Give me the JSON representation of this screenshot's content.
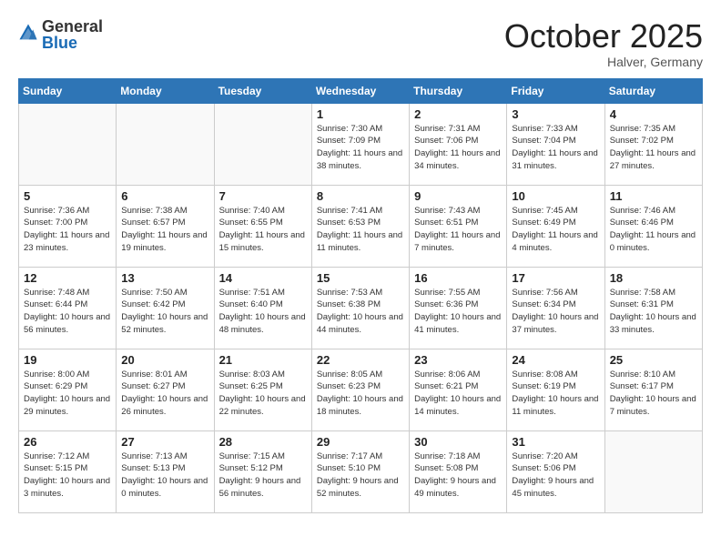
{
  "header": {
    "logo_general": "General",
    "logo_blue": "Blue",
    "month_title": "October 2025",
    "location": "Halver, Germany"
  },
  "days_of_week": [
    "Sunday",
    "Monday",
    "Tuesday",
    "Wednesday",
    "Thursday",
    "Friday",
    "Saturday"
  ],
  "weeks": [
    [
      {
        "day": "",
        "info": ""
      },
      {
        "day": "",
        "info": ""
      },
      {
        "day": "",
        "info": ""
      },
      {
        "day": "1",
        "info": "Sunrise: 7:30 AM\nSunset: 7:09 PM\nDaylight: 11 hours\nand 38 minutes."
      },
      {
        "day": "2",
        "info": "Sunrise: 7:31 AM\nSunset: 7:06 PM\nDaylight: 11 hours\nand 34 minutes."
      },
      {
        "day": "3",
        "info": "Sunrise: 7:33 AM\nSunset: 7:04 PM\nDaylight: 11 hours\nand 31 minutes."
      },
      {
        "day": "4",
        "info": "Sunrise: 7:35 AM\nSunset: 7:02 PM\nDaylight: 11 hours\nand 27 minutes."
      }
    ],
    [
      {
        "day": "5",
        "info": "Sunrise: 7:36 AM\nSunset: 7:00 PM\nDaylight: 11 hours\nand 23 minutes."
      },
      {
        "day": "6",
        "info": "Sunrise: 7:38 AM\nSunset: 6:57 PM\nDaylight: 11 hours\nand 19 minutes."
      },
      {
        "day": "7",
        "info": "Sunrise: 7:40 AM\nSunset: 6:55 PM\nDaylight: 11 hours\nand 15 minutes."
      },
      {
        "day": "8",
        "info": "Sunrise: 7:41 AM\nSunset: 6:53 PM\nDaylight: 11 hours\nand 11 minutes."
      },
      {
        "day": "9",
        "info": "Sunrise: 7:43 AM\nSunset: 6:51 PM\nDaylight: 11 hours\nand 7 minutes."
      },
      {
        "day": "10",
        "info": "Sunrise: 7:45 AM\nSunset: 6:49 PM\nDaylight: 11 hours\nand 4 minutes."
      },
      {
        "day": "11",
        "info": "Sunrise: 7:46 AM\nSunset: 6:46 PM\nDaylight: 11 hours\nand 0 minutes."
      }
    ],
    [
      {
        "day": "12",
        "info": "Sunrise: 7:48 AM\nSunset: 6:44 PM\nDaylight: 10 hours\nand 56 minutes."
      },
      {
        "day": "13",
        "info": "Sunrise: 7:50 AM\nSunset: 6:42 PM\nDaylight: 10 hours\nand 52 minutes."
      },
      {
        "day": "14",
        "info": "Sunrise: 7:51 AM\nSunset: 6:40 PM\nDaylight: 10 hours\nand 48 minutes."
      },
      {
        "day": "15",
        "info": "Sunrise: 7:53 AM\nSunset: 6:38 PM\nDaylight: 10 hours\nand 44 minutes."
      },
      {
        "day": "16",
        "info": "Sunrise: 7:55 AM\nSunset: 6:36 PM\nDaylight: 10 hours\nand 41 minutes."
      },
      {
        "day": "17",
        "info": "Sunrise: 7:56 AM\nSunset: 6:34 PM\nDaylight: 10 hours\nand 37 minutes."
      },
      {
        "day": "18",
        "info": "Sunrise: 7:58 AM\nSunset: 6:31 PM\nDaylight: 10 hours\nand 33 minutes."
      }
    ],
    [
      {
        "day": "19",
        "info": "Sunrise: 8:00 AM\nSunset: 6:29 PM\nDaylight: 10 hours\nand 29 minutes."
      },
      {
        "day": "20",
        "info": "Sunrise: 8:01 AM\nSunset: 6:27 PM\nDaylight: 10 hours\nand 26 minutes."
      },
      {
        "day": "21",
        "info": "Sunrise: 8:03 AM\nSunset: 6:25 PM\nDaylight: 10 hours\nand 22 minutes."
      },
      {
        "day": "22",
        "info": "Sunrise: 8:05 AM\nSunset: 6:23 PM\nDaylight: 10 hours\nand 18 minutes."
      },
      {
        "day": "23",
        "info": "Sunrise: 8:06 AM\nSunset: 6:21 PM\nDaylight: 10 hours\nand 14 minutes."
      },
      {
        "day": "24",
        "info": "Sunrise: 8:08 AM\nSunset: 6:19 PM\nDaylight: 10 hours\nand 11 minutes."
      },
      {
        "day": "25",
        "info": "Sunrise: 8:10 AM\nSunset: 6:17 PM\nDaylight: 10 hours\nand 7 minutes."
      }
    ],
    [
      {
        "day": "26",
        "info": "Sunrise: 7:12 AM\nSunset: 5:15 PM\nDaylight: 10 hours\nand 3 minutes."
      },
      {
        "day": "27",
        "info": "Sunrise: 7:13 AM\nSunset: 5:13 PM\nDaylight: 10 hours\nand 0 minutes."
      },
      {
        "day": "28",
        "info": "Sunrise: 7:15 AM\nSunset: 5:12 PM\nDaylight: 9 hours\nand 56 minutes."
      },
      {
        "day": "29",
        "info": "Sunrise: 7:17 AM\nSunset: 5:10 PM\nDaylight: 9 hours\nand 52 minutes."
      },
      {
        "day": "30",
        "info": "Sunrise: 7:18 AM\nSunset: 5:08 PM\nDaylight: 9 hours\nand 49 minutes."
      },
      {
        "day": "31",
        "info": "Sunrise: 7:20 AM\nSunset: 5:06 PM\nDaylight: 9 hours\nand 45 minutes."
      },
      {
        "day": "",
        "info": ""
      }
    ]
  ]
}
